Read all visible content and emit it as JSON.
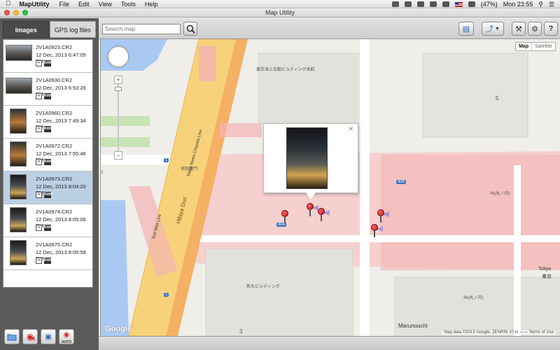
{
  "menubar": {
    "app_name": "MapUtility",
    "menus": [
      "File",
      "Edit",
      "View",
      "Tools",
      "Help"
    ],
    "battery": "(47%)",
    "clock": "Mon 23:55"
  },
  "window": {
    "title": "Map Utility"
  },
  "tabs": [
    {
      "label": "Images",
      "active": true
    },
    {
      "label": "GPS log files",
      "active": false
    }
  ],
  "search": {
    "placeholder": "Search map"
  },
  "images": [
    {
      "name": "2V1A0923.CR2",
      "date": "12 Dec, 2013 6:47:05 PM",
      "thumb": "wide",
      "selected": false
    },
    {
      "name": "2V1A0930.CR2",
      "date": "12 Dec, 2013 6:53:26 PM",
      "thumb": "wide",
      "selected": false
    },
    {
      "name": "2V1A0960.CR2",
      "date": "12 Dec, 2013 7:49:34 PM",
      "thumb": "tall",
      "selected": false
    },
    {
      "name": "2V1A0972.CR2",
      "date": "12 Dec, 2013 7:55:46 PM",
      "thumb": "tall",
      "selected": false
    },
    {
      "name": "2V1A0973.CR2",
      "date": "12 Dec, 2013 8:04:20 PM",
      "thumb": "night",
      "selected": true
    },
    {
      "name": "2V1A0974.CR2",
      "date": "12 Dec, 2013 8:05:06 PM",
      "thumb": "night",
      "selected": false
    },
    {
      "name": "2V1A0975.CR2",
      "date": "12 Dec, 2013 8:05:58 PM",
      "thumb": "night",
      "selected": false
    }
  ],
  "raw_badge": "RAW",
  "bottom_buttons": {
    "auto_label": "AUTO"
  },
  "map": {
    "type_selected": "Map",
    "type_other": "Satellite",
    "google_logo": "Google",
    "copyright": "Map data ©2013 Google, ZENRIN   10 m ——   Terms of Use",
    "labels": {
      "marunouchi": "Marunouchi",
      "tokyo": "Tokyo",
      "tokyo_jp": "東京",
      "route_404": "404",
      "route_1": "1",
      "hibiya_dori": "Hibiya Dori",
      "chiyoda_line": "Tokyo Metro Chiyoda Line",
      "toei_mita_line": "Toei Mita Line",
      "building_top": "東京海上日動ビルディング本館",
      "building_mid": "新丸ビルディング",
      "shop": "実田経門",
      "num_5": "5",
      "num_3": "3",
      "num_2": "2",
      "label_4k": "4k(丸ノ内)",
      "label_4b": "4b(丸ノ内)"
    }
  },
  "colors": {
    "selected_row": "#bcd0e4",
    "road_major": "#f7d27a",
    "road_orange": "#f4b063",
    "pink_area": "#f6c8c8",
    "water": "#a9c9f2",
    "park": "#c8e3b4"
  }
}
